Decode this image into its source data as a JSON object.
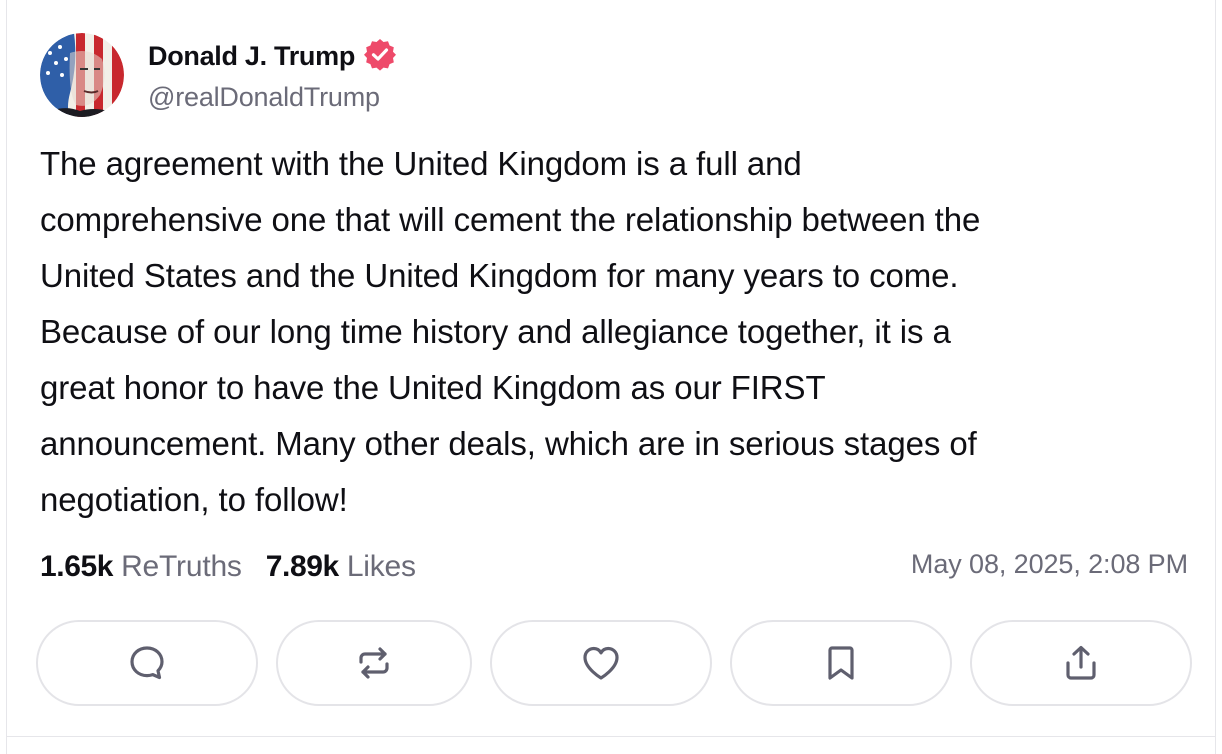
{
  "post": {
    "author": {
      "display_name": "Donald J. Trump",
      "handle": "@realDonaldTrump",
      "verified": true,
      "avatar_icon": "flag-portrait-avatar",
      "verified_badge_color": "#ee4a6a"
    },
    "text": "The agreement with the United Kingdom is a full and\ncomprehensive one that will cement the relationship between the\nUnited States and the United Kingdom for many years to come.\nBecause of our long time history and allegiance together, it is a\ngreat honor to have the United Kingdom as our FIRST\nannouncement. Many other deals, which are in serious stages of\nnegotiation, to follow!",
    "stats": {
      "retruths_count": "1.65k",
      "retruths_label": "ReTruths",
      "likes_count": "7.89k",
      "likes_label": "Likes"
    },
    "timestamp": "May 08, 2025, 2:08 PM"
  },
  "actions": [
    {
      "name": "reply",
      "icon": "comment-icon"
    },
    {
      "name": "retruth",
      "icon": "repost-icon"
    },
    {
      "name": "like",
      "icon": "heart-icon"
    },
    {
      "name": "bookmark",
      "icon": "bookmark-icon"
    },
    {
      "name": "share",
      "icon": "share-icon"
    }
  ],
  "colors": {
    "text_primary": "#0f0f14",
    "text_secondary": "#6b6b78",
    "border": "#e4e4e8",
    "icon": "#5f5f6e"
  }
}
